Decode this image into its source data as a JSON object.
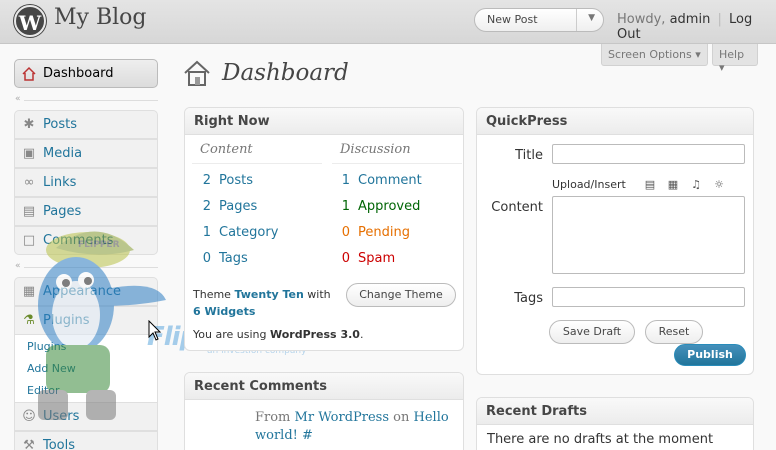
{
  "header": {
    "site_title": "My Blog",
    "logo_glyph": "W",
    "new_post": "New Post",
    "howdy": "Howdy,",
    "username": "admin",
    "logout": "Log Out"
  },
  "tabs": {
    "screen_options": "Screen Options ▾",
    "help": "Help ▾"
  },
  "sidebar": {
    "dashboard": "Dashboard",
    "posts": "Posts",
    "media": "Media",
    "links": "Links",
    "pages": "Pages",
    "comments": "Comments",
    "appearance": "Appearance",
    "plugins": "Plugins",
    "plugins_sub": [
      "Plugins",
      "Add New",
      "Editor"
    ],
    "users": "Users",
    "tools": "Tools"
  },
  "page": {
    "title": "Dashboard"
  },
  "right_now": {
    "title": "Right Now",
    "content_head": "Content",
    "discussion_head": "Discussion",
    "content": [
      {
        "num": "2",
        "label": "Posts"
      },
      {
        "num": "2",
        "label": "Pages"
      },
      {
        "num": "1",
        "label": "Category"
      },
      {
        "num": "0",
        "label": "Tags"
      }
    ],
    "discussion": [
      {
        "num": "1",
        "label": "Comment"
      },
      {
        "num": "1",
        "label": "Approved"
      },
      {
        "num": "0",
        "label": "Pending"
      },
      {
        "num": "0",
        "label": "Spam"
      }
    ],
    "theme_prefix": "Theme",
    "theme_name": "Twenty Ten",
    "theme_with": "with",
    "widgets": "6 Widgets",
    "change_theme": "Change Theme",
    "version_prefix": "You are using",
    "version": "WordPress 3.0",
    "version_suffix": "."
  },
  "quickpress": {
    "title": "QuickPress",
    "title_label": "Title",
    "upload_insert": "Upload/Insert",
    "content_label": "Content",
    "tags_label": "Tags",
    "save_draft": "Save Draft",
    "reset": "Reset",
    "publish": "Publish"
  },
  "recent_comments": {
    "title": "Recent Comments",
    "from": "From",
    "author": "Mr WordPress",
    "on": "on",
    "post": "Hello world!",
    "hash": "#"
  },
  "recent_drafts": {
    "title": "Recent Drafts",
    "empty": "There are no drafts at the moment"
  },
  "watermark": {
    "brand": "FlipperHost",
    "tagline": "an investion company",
    "cap_text": "FLIPPER"
  }
}
